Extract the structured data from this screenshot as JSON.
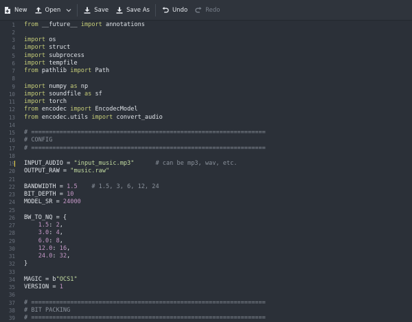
{
  "toolbar": {
    "new_label": "New",
    "open_label": "Open",
    "save_label": "Save",
    "save_as_label": "Save As",
    "undo_label": "Undo",
    "redo_label": "Redo",
    "icons": {
      "new": "new-file-icon",
      "open": "upload-icon",
      "open_menu": "chevron-down-icon",
      "save": "download-icon",
      "save_as": "save-as-icon",
      "undo": "undo-icon",
      "redo": "redo-icon"
    }
  },
  "colors": {
    "background": "#2b3038",
    "keyword": "#c6cd78",
    "string": "#c3dca0",
    "number": "#c497c6",
    "comment": "#8a919b",
    "text": "#dfe3e8",
    "line_number": "#6a717c",
    "current_line_marker": "#e2c93a"
  },
  "editor": {
    "current_line": 19,
    "lines": [
      [
        {
          "t": "from",
          "c": "kw"
        },
        {
          "t": " __future__ "
        },
        {
          "t": "import",
          "c": "kw"
        },
        {
          "t": " annotations"
        }
      ],
      [],
      [
        {
          "t": "import",
          "c": "kw"
        },
        {
          "t": " os"
        }
      ],
      [
        {
          "t": "import",
          "c": "kw"
        },
        {
          "t": " struct"
        }
      ],
      [
        {
          "t": "import",
          "c": "kw"
        },
        {
          "t": " subprocess"
        }
      ],
      [
        {
          "t": "import",
          "c": "kw"
        },
        {
          "t": " tempfile"
        }
      ],
      [
        {
          "t": "from",
          "c": "kw"
        },
        {
          "t": " pathlib "
        },
        {
          "t": "import",
          "c": "kw"
        },
        {
          "t": " Path"
        }
      ],
      [],
      [
        {
          "t": "import",
          "c": "kw"
        },
        {
          "t": " numpy "
        },
        {
          "t": "as",
          "c": "kw"
        },
        {
          "t": " np"
        }
      ],
      [
        {
          "t": "import",
          "c": "kw"
        },
        {
          "t": " soundfile "
        },
        {
          "t": "as",
          "c": "kw"
        },
        {
          "t": " sf"
        }
      ],
      [
        {
          "t": "import",
          "c": "kw"
        },
        {
          "t": " torch"
        }
      ],
      [
        {
          "t": "from",
          "c": "kw"
        },
        {
          "t": " encodec "
        },
        {
          "t": "import",
          "c": "kw"
        },
        {
          "t": " EncodecModel"
        }
      ],
      [
        {
          "t": "from",
          "c": "kw"
        },
        {
          "t": " encodec.utils "
        },
        {
          "t": "import",
          "c": "kw"
        },
        {
          "t": " convert_audio"
        }
      ],
      [],
      [
        {
          "t": "# ==================================================================",
          "c": "com"
        }
      ],
      [
        {
          "t": "# CONFIG",
          "c": "com"
        }
      ],
      [
        {
          "t": "# ==================================================================",
          "c": "com"
        }
      ],
      [],
      [
        {
          "t": "INPUT_AUDIO = "
        },
        {
          "t": "\"input_music.mp3\"",
          "c": "str"
        },
        {
          "t": "      "
        },
        {
          "t": "# can be mp3, wav, etc.",
          "c": "com"
        }
      ],
      [
        {
          "t": "OUTPUT_RAW = "
        },
        {
          "t": "\"music.raw\"",
          "c": "str"
        }
      ],
      [],
      [
        {
          "t": "BANDWIDTH = "
        },
        {
          "t": "1.5",
          "c": "num"
        },
        {
          "t": "    "
        },
        {
          "t": "# 1.5, 3, 6, 12, 24",
          "c": "com"
        }
      ],
      [
        {
          "t": "BIT_DEPTH = "
        },
        {
          "t": "10",
          "c": "num"
        }
      ],
      [
        {
          "t": "MODEL_SR = "
        },
        {
          "t": "24000",
          "c": "num"
        }
      ],
      [],
      [
        {
          "t": "BW_TO_NQ = {"
        }
      ],
      [
        {
          "t": "    "
        },
        {
          "t": "1.5",
          "c": "num"
        },
        {
          "t": ": "
        },
        {
          "t": "2",
          "c": "num"
        },
        {
          "t": ","
        }
      ],
      [
        {
          "t": "    "
        },
        {
          "t": "3.0",
          "c": "num"
        },
        {
          "t": ": "
        },
        {
          "t": "4",
          "c": "num"
        },
        {
          "t": ","
        }
      ],
      [
        {
          "t": "    "
        },
        {
          "t": "6.0",
          "c": "num"
        },
        {
          "t": ": "
        },
        {
          "t": "8",
          "c": "num"
        },
        {
          "t": ","
        }
      ],
      [
        {
          "t": "    "
        },
        {
          "t": "12.0",
          "c": "num"
        },
        {
          "t": ": "
        },
        {
          "t": "16",
          "c": "num"
        },
        {
          "t": ","
        }
      ],
      [
        {
          "t": "    "
        },
        {
          "t": "24.0",
          "c": "num"
        },
        {
          "t": ": "
        },
        {
          "t": "32",
          "c": "num"
        },
        {
          "t": ","
        }
      ],
      [
        {
          "t": "}"
        }
      ],
      [],
      [
        {
          "t": "MAGIC = b"
        },
        {
          "t": "\"OCS1\"",
          "c": "str"
        }
      ],
      [
        {
          "t": "VERSION = "
        },
        {
          "t": "1",
          "c": "num"
        }
      ],
      [],
      [
        {
          "t": "# ==================================================================",
          "c": "com"
        }
      ],
      [
        {
          "t": "# BIT PACKING",
          "c": "com"
        }
      ],
      [
        {
          "t": "# ==================================================================",
          "c": "com"
        }
      ]
    ]
  }
}
